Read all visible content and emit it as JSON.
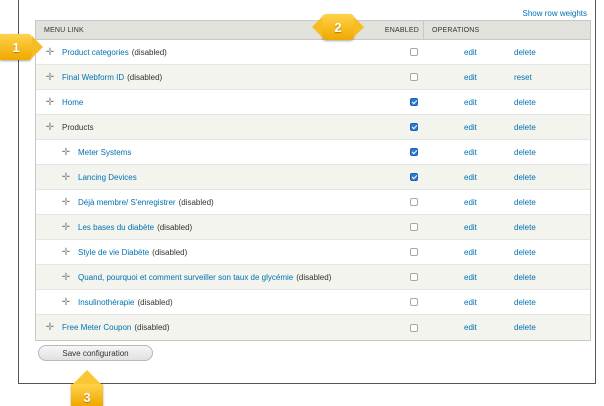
{
  "header": {
    "show_row_weights": "Show row weights"
  },
  "table": {
    "columns": {
      "menu_link": "MENU LINK",
      "enabled": "ENABLED",
      "operations": "OPERATIONS"
    },
    "rows": [
      {
        "title": "Product categories",
        "suffix": "(disabled)",
        "enabled": false,
        "edit": "edit",
        "op2": "delete",
        "indent": 0
      },
      {
        "title": "Final Webform ID",
        "suffix": "(disabled)",
        "enabled": false,
        "edit": "edit",
        "op2": "reset",
        "indent": 0
      },
      {
        "title": "Home",
        "suffix": "",
        "enabled": true,
        "edit": "edit",
        "op2": "delete",
        "indent": 0
      },
      {
        "title": "Products",
        "suffix": "",
        "enabled": true,
        "edit": "edit",
        "op2": "delete",
        "indent": 0,
        "plain": true
      },
      {
        "title": "Meter Systems",
        "suffix": "",
        "enabled": true,
        "edit": "edit",
        "op2": "delete",
        "indent": 1
      },
      {
        "title": "Lancing Devices",
        "suffix": "",
        "enabled": true,
        "edit": "edit",
        "op2": "delete",
        "indent": 1
      },
      {
        "title": "Déjà membre/ S'enregistrer",
        "suffix": "(disabled)",
        "enabled": false,
        "edit": "edit",
        "op2": "delete",
        "indent": 1
      },
      {
        "title": "Les bases du diabète",
        "suffix": "(disabled)",
        "enabled": false,
        "edit": "edit",
        "op2": "delete",
        "indent": 1
      },
      {
        "title": "Style de vie Diabète",
        "suffix": "(disabled)",
        "enabled": false,
        "edit": "edit",
        "op2": "delete",
        "indent": 1
      },
      {
        "title": "Quand, pourquoi et comment surveiller son taux de glycémie",
        "suffix": "(disabled)",
        "enabled": false,
        "edit": "edit",
        "op2": "delete",
        "indent": 1
      },
      {
        "title": "Insulinothérapie",
        "suffix": "(disabled)",
        "enabled": false,
        "edit": "edit",
        "op2": "delete",
        "indent": 1
      },
      {
        "title": "Free Meter Coupon",
        "suffix": "(disabled)",
        "enabled": false,
        "edit": "edit",
        "op2": "delete",
        "indent": 0
      }
    ]
  },
  "actions": {
    "save_label": "Save configuration"
  },
  "callouts": {
    "one": "1",
    "two": "2",
    "three": "3"
  },
  "colors": {
    "link": "#0071b3",
    "header_bg": "#e1e2dc",
    "callout": "#f6bd22",
    "checkbox_on": "#2a7ad8"
  },
  "icons": {
    "drag_handle": "drag-handle-icon"
  }
}
